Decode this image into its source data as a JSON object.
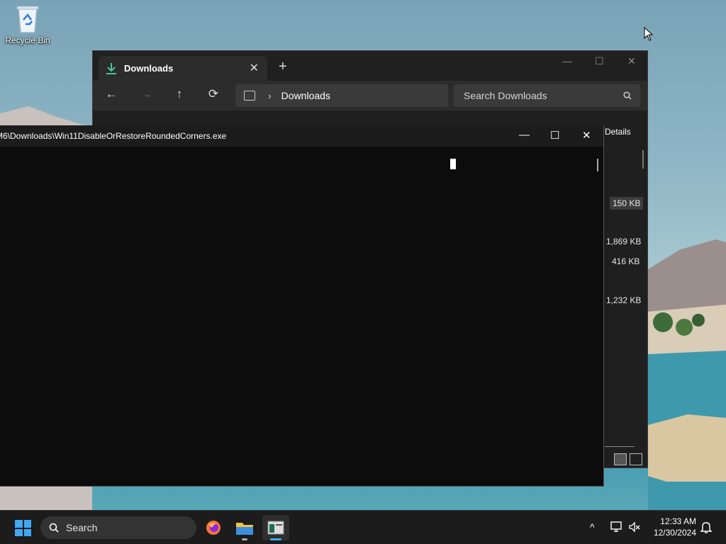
{
  "desktop": {
    "recycle_bin_label": "Recycle Bin"
  },
  "explorer": {
    "tab_label": "Downloads",
    "tab_close": "✕",
    "new_tab": "+",
    "minimize": "—",
    "maximize": "☐",
    "close": "✕",
    "nav": {
      "back": "←",
      "forward": "→",
      "up": "↑",
      "refresh": "⟳"
    },
    "address_chevron": "›",
    "address_text": "Downloads",
    "search_placeholder": "Search Downloads",
    "details_label": "Details",
    "sizes": [
      "150 KB",
      "1,869 KB",
      "416 KB",
      "1,232 KB"
    ]
  },
  "console": {
    "title": "M6\\Downloads\\Win11DisableOrRestoreRoundedCorners.exe",
    "minimize": "—",
    "maximize": "☐",
    "close": "✕"
  },
  "taskbar": {
    "search_label": "Search",
    "tray_chevron": "^",
    "time": "12:33 AM",
    "date": "12/30/2024"
  },
  "colors": {
    "accent": "#3fa9f5",
    "download_green": "#4cc2a0"
  }
}
